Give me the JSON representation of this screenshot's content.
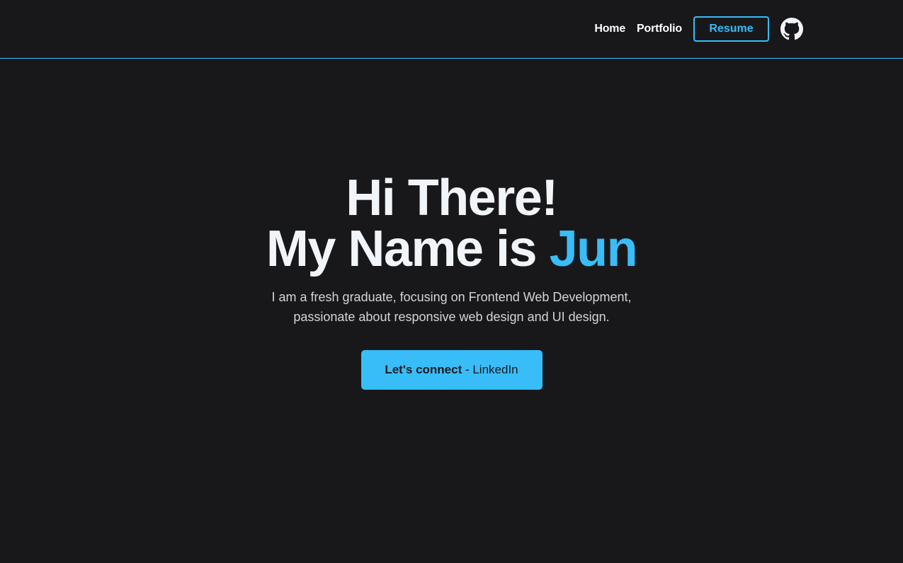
{
  "nav": {
    "links": [
      {
        "label": "Home"
      },
      {
        "label": "Portfolio"
      }
    ],
    "resume_label": "Resume",
    "github_icon": "github-icon"
  },
  "hero": {
    "title_line1": "Hi There!",
    "title_line2_prefix": "My Name is ",
    "title_name": "Jun",
    "description_line1": "I am a fresh graduate, focusing on Frontend Web Development,",
    "description_line2": "passionate about responsive web design and UI design.",
    "cta_bold": "Let's connect",
    "cta_rest": " - LinkedIn"
  },
  "colors": {
    "background": "#18181b",
    "accent": "#38bdf8",
    "text": "#f1f5f9"
  }
}
